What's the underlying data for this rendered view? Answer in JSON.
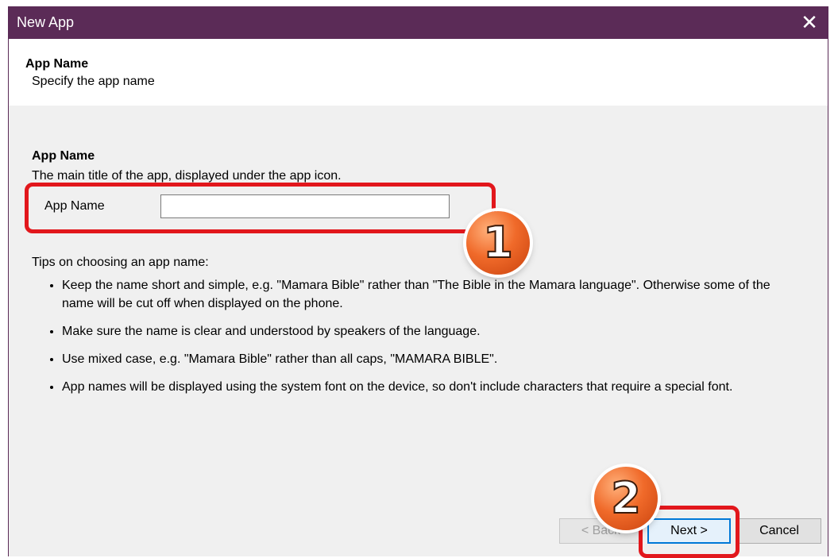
{
  "window": {
    "title": "New App",
    "close_glyph": "✕"
  },
  "header": {
    "title": "App Name",
    "subtitle": "Specify the app name"
  },
  "section": {
    "title": "App Name",
    "description": "The main title of the app, displayed under the app icon.",
    "field_label": "App Name",
    "field_value": ""
  },
  "tips": {
    "title": "Tips on choosing an app name:",
    "items": [
      "Keep the name short and simple, e.g. \"Mamara Bible\" rather than \"The Bible in the Mamara language\". Otherwise some of the name will be cut off when displayed on the phone.",
      "Make sure the name is clear and understood by speakers of the language.",
      "Use mixed case, e.g. \"Mamara Bible\" rather than all caps, \"MAMARA BIBLE\".",
      "App names will be displayed using the system font on the device, so don't include characters that require a special font."
    ]
  },
  "buttons": {
    "back": "< Back",
    "next": "Next >",
    "cancel": "Cancel"
  },
  "annotations": {
    "badge_1": "1",
    "badge_2": "2"
  },
  "colors": {
    "titlebar": "#5b2b57",
    "highlight": "#e2171c",
    "badge": "#f06a2a",
    "focus": "#0078d7"
  }
}
